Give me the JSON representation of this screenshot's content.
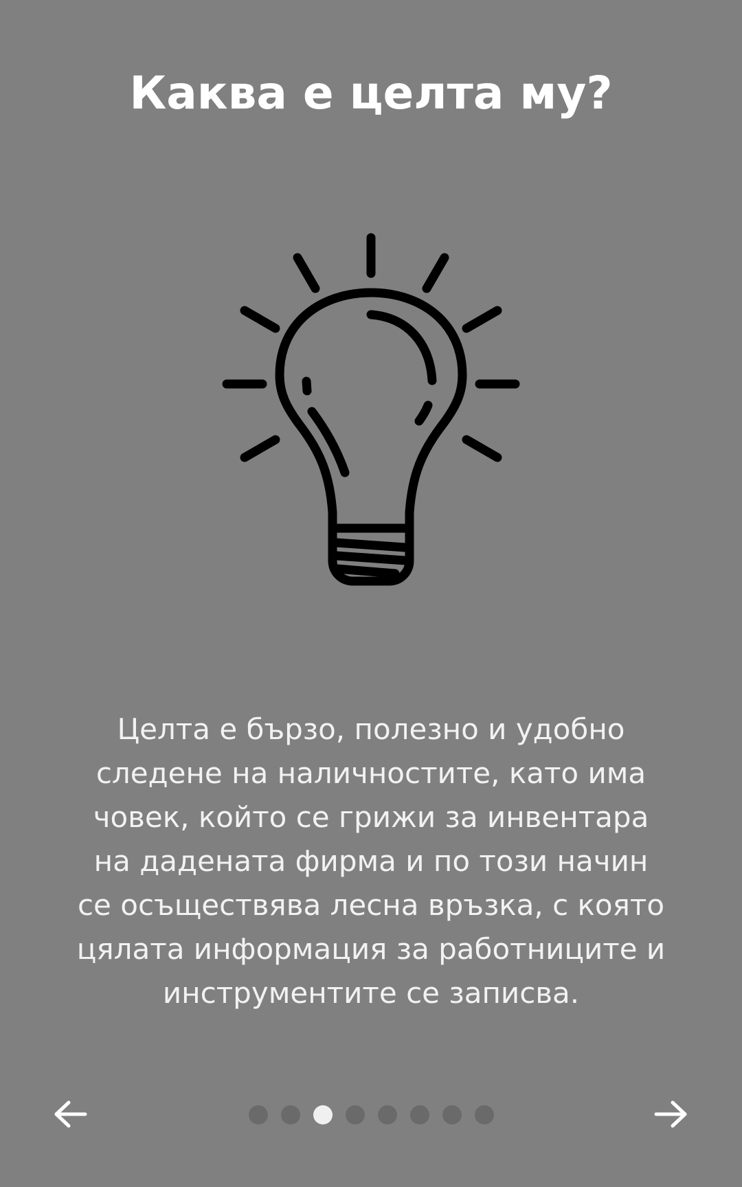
{
  "screen": {
    "title": "Каква е целта му?",
    "description_lines": [
      "Целта е бързо, полезно и удобно",
      "следене на наличностите, като има",
      "човек, който се грижи за инвентара",
      "на дадената фирма и по този начин",
      "се осъществява лесна връзка, с която",
      "цялата информация за работниците и",
      "инструментите се записва."
    ],
    "illustration_icon": "light-bulb-icon"
  },
  "pager": {
    "total_pages": 8,
    "current_page": 3,
    "prev_icon": "arrow-left-icon",
    "next_icon": "arrow-right-icon"
  },
  "colors": {
    "background": "#808080",
    "text": "#ffffff",
    "dot_active": "#f0f0f0",
    "dot_inactive": "#6a6a6a",
    "icon_stroke": "#000000"
  }
}
